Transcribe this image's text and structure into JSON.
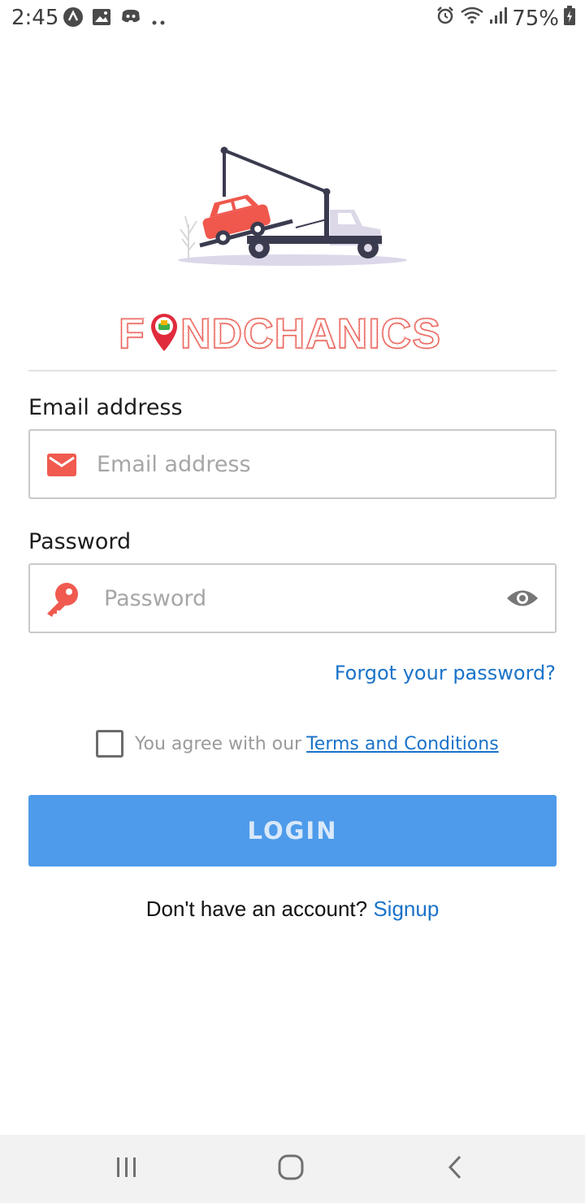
{
  "status_bar": {
    "time": "2:45",
    "battery": "75%",
    "left_icons": [
      "navigation-app-icon",
      "gallery-icon",
      "discord-icon",
      "more-dots-icon"
    ],
    "right_icons": [
      "alarm-icon",
      "wifi-icon",
      "signal-icon",
      "battery-charging-icon"
    ]
  },
  "brand": {
    "name": "FINDCHANICS",
    "accent_color": "#e8544a"
  },
  "login_form": {
    "email_label": "Email address",
    "email_placeholder": "Email address",
    "email_value": "",
    "password_label": "Password",
    "password_placeholder": "Password",
    "password_value": "",
    "forgot_password": "Forgot your password?",
    "terms_text": "You agree with our",
    "terms_link": "Terms and Conditions",
    "terms_checked": false,
    "login_button": "LOGIN",
    "signup_prompt": "Don't have an account?",
    "signup_link": "Signup"
  },
  "nav_bar": {
    "buttons": [
      "recent-apps",
      "home",
      "back"
    ]
  },
  "colors": {
    "primary_button": "#4d9bea",
    "link": "#1a73c9",
    "icon_accent": "#f05a4f"
  }
}
